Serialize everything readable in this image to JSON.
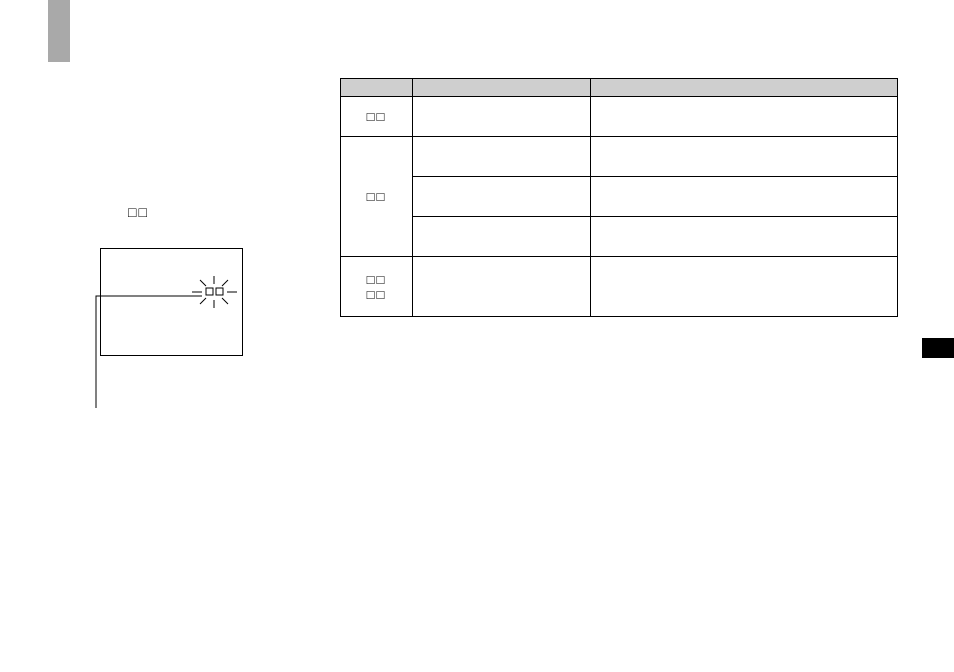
{
  "left_label": "□□",
  "table": {
    "headers": [
      "",
      "",
      ""
    ],
    "rows": [
      {
        "sym": "□□",
        "col2": "",
        "col3": ""
      },
      {
        "sym": "□□",
        "sub": [
          {
            "col2": "",
            "col3": ""
          },
          {
            "col2": "",
            "col3": ""
          },
          {
            "col2": "",
            "col3": ""
          }
        ]
      },
      {
        "sym": "□□\n□□",
        "col2": "",
        "col3": ""
      }
    ]
  }
}
